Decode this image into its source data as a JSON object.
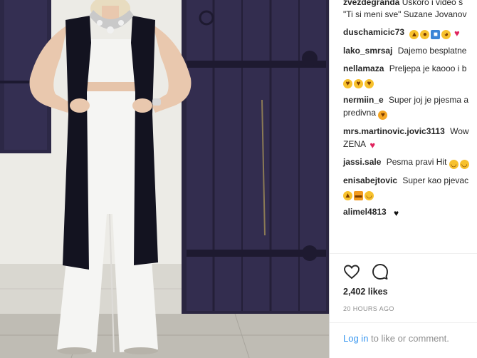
{
  "post": {
    "username": "zvezdegranda",
    "caption_line1": "Uskoro i video s",
    "caption_line2": "\"Ti si meni sve\" Suzane Jovanov"
  },
  "comments": [
    {
      "user": "duschamicic73",
      "text": "",
      "emojis": [
        "thumbs-up",
        "ok-hand",
        "blue-square",
        "wink",
        "heart"
      ]
    },
    {
      "user": "lako_smrsaj",
      "text": "Dajemo besplatne",
      "emojis": []
    },
    {
      "user": "nellamaza",
      "text": "Preljepa je kaooo i b",
      "emojis": [
        "heart-eyes",
        "heart-eyes",
        "heart-eyes"
      ]
    },
    {
      "user": "nermiin_e",
      "text": "Super joj je pjesma a",
      "text2": "predivna",
      "emojis": [
        "cat-heart-eyes"
      ]
    },
    {
      "user": "mrs.martinovic.jovic3113",
      "text": "Wow",
      "text2": "ZENA",
      "emojis": [
        "sparkling-heart"
      ]
    },
    {
      "user": "jassi.sale",
      "text": "Pesma pravi Hit",
      "emojis": [
        "smile",
        "smile"
      ]
    },
    {
      "user": "enisabejtovic",
      "text": "Super kao pjevac",
      "emojis": [
        "thumbs-up",
        "battery",
        "smile"
      ]
    },
    {
      "user": "alimel4813",
      "text": "",
      "emojis": [
        "black-heart"
      ]
    }
  ],
  "actions": {
    "like_icon": "heart-outline-icon",
    "comment_icon": "comment-bubble-icon"
  },
  "likes": "2,402 likes",
  "timestamp": "20 HOURS AGO",
  "login": {
    "link": "Log in",
    "rest": " to like or comment."
  },
  "colors": {
    "link": "#3897f0",
    "text": "#262626",
    "muted": "#8e8e8e",
    "door": "#2a2540",
    "wall": "#e9e7e2"
  }
}
